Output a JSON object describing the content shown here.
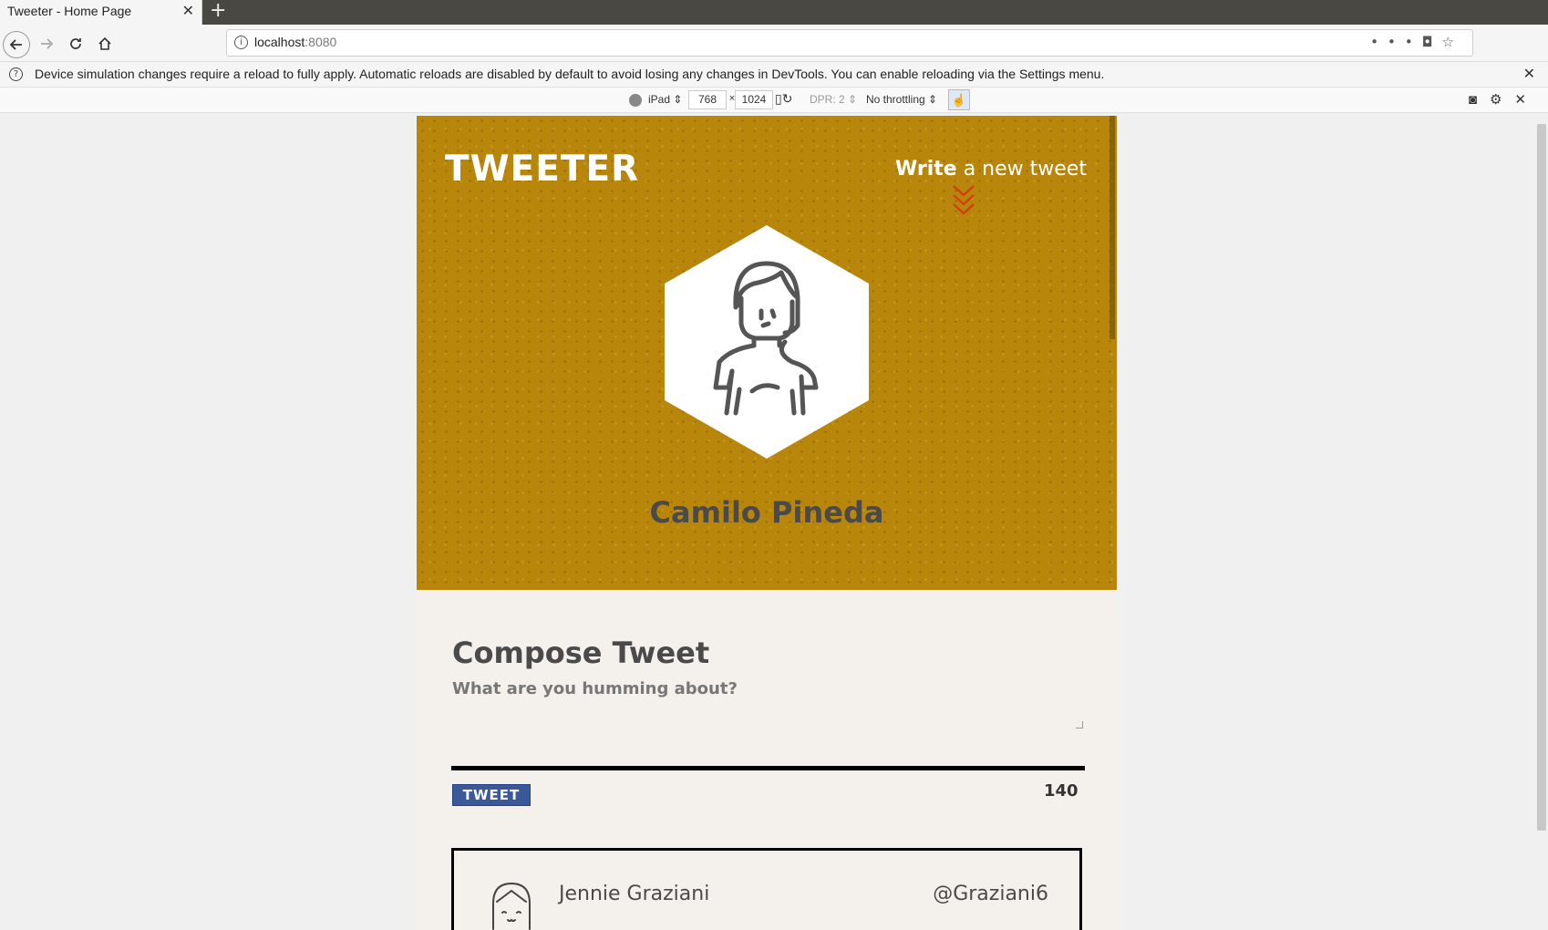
{
  "browser": {
    "tab_title": "Tweeter - Home Page",
    "tab_close": "✕",
    "new_tab": "+",
    "url_host": "localhost",
    "url_port": ":8080",
    "url_menu": "•••",
    "info_message": "Device simulation changes require a reload to fully apply. Automatic reloads are disabled by default to avoid losing any changes in DevTools. You can enable reloading via the Settings menu."
  },
  "devtools": {
    "device": "iPad ⇕",
    "width": "768",
    "height": "1024",
    "times": "×",
    "dpr": "DPR: 2 ⇕",
    "throttling": "No throttling ⇕"
  },
  "page": {
    "logo": "TWEETER",
    "write_strong": "Write",
    "write_rest": " a new tweet",
    "user_name": "Camilo Pineda",
    "compose_title": "Compose Tweet",
    "compose_placeholder": "What are you humming about?",
    "tweet_button": "TWEET",
    "counter": "140",
    "tweets": [
      {
        "name": "Jennie Graziani",
        "handle": "@Graziani6"
      }
    ]
  },
  "colors": {
    "hero_bg": "#b8860b",
    "text_dark": "#4a4a4a",
    "button_bg": "#3b5998",
    "arrow_red": "#d43c00"
  }
}
